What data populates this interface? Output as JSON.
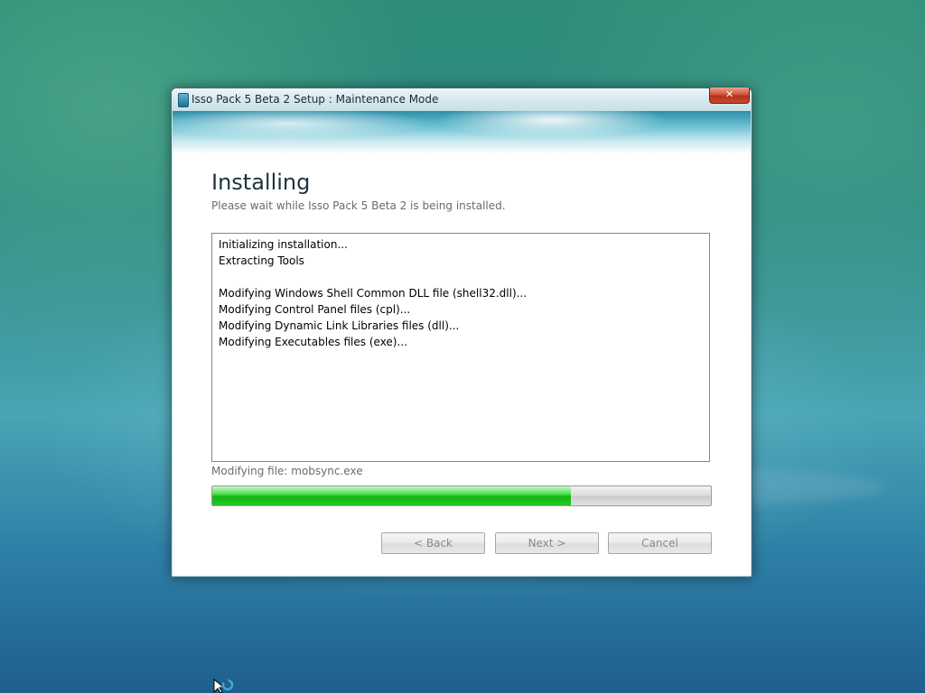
{
  "window": {
    "title": "Isso Pack 5 Beta 2 Setup : Maintenance Mode",
    "close_glyph": "✕"
  },
  "page": {
    "heading": "Installing",
    "subheading": "Please wait while Isso Pack 5 Beta 2 is being installed."
  },
  "log": [
    "Initializing installation...",
    "Extracting Tools",
    "",
    "Modifying Windows Shell Common DLL file (shell32.dll)...",
    "Modifying Control Panel files (cpl)...",
    "Modifying Dynamic Link Libraries files (dll)...",
    "Modifying Executables files (exe)..."
  ],
  "status": {
    "current_file": "Modifying file: mobsync.exe"
  },
  "progress": {
    "fraction": 0.72
  },
  "buttons": {
    "back": "< Back",
    "next": "Next >",
    "cancel": "Cancel"
  },
  "colors": {
    "progress_fill": "#11b511",
    "close_button": "#c84a2c"
  },
  "icons": {
    "app": "setup-app-icon",
    "close": "close-icon",
    "cursor": "busy-cursor-icon"
  }
}
